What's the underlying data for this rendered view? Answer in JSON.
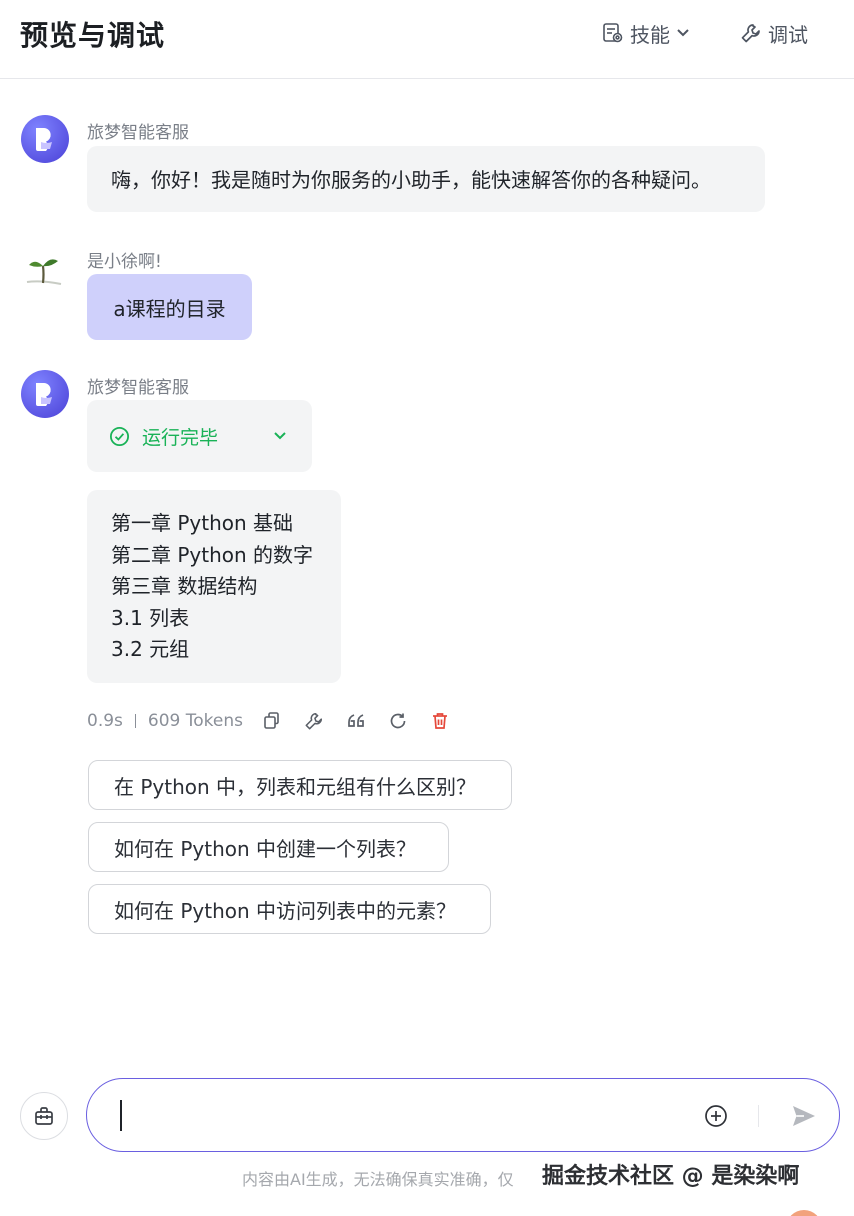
{
  "header": {
    "title": "预览与调试",
    "skill_label": "技能",
    "debug_label": "调试"
  },
  "messages": {
    "bot_name": "旅梦智能客服",
    "greeting": "嗨，你好！我是随时为你服务的小助手，能快速解答你的各种疑问。",
    "user_name": "是小徐啊!",
    "user_message": "a课程的目录",
    "status_label": "运行完毕",
    "answer_lines": [
      "第一章 Python 基础",
      "第二章 Python 的数字",
      "第三章 数据结构",
      "3.1 列表",
      "3.2 元组"
    ],
    "meta": {
      "duration": "0.9s",
      "tokens": "609 Tokens"
    }
  },
  "suggestions": [
    "在 Python 中，列表和元组有什么区别？",
    "如何在 Python 中创建一个列表？",
    "如何在 Python 中访问列表中的元素？"
  ],
  "input": {
    "value": "",
    "placeholder": ""
  },
  "footer": {
    "disclaimer": "内容由AI生成，无法确保真实准确，仅",
    "watermark": "掘金技术社区 @ 是染染啊"
  },
  "colors": {
    "accent": "#6a5fe0",
    "user_bubble": "#cfd0fb",
    "success": "#19b257",
    "danger": "#e5483a"
  },
  "icons": {
    "skill": "skill-doc-icon",
    "debug": "wrench-icon",
    "copy": "copy-icon",
    "debug_action": "wrench-icon",
    "quote": "quote-icon",
    "regenerate": "refresh-icon",
    "delete": "trash-icon",
    "toolbox": "toolbox-icon",
    "add": "plus-circle-icon",
    "send": "send-icon"
  }
}
